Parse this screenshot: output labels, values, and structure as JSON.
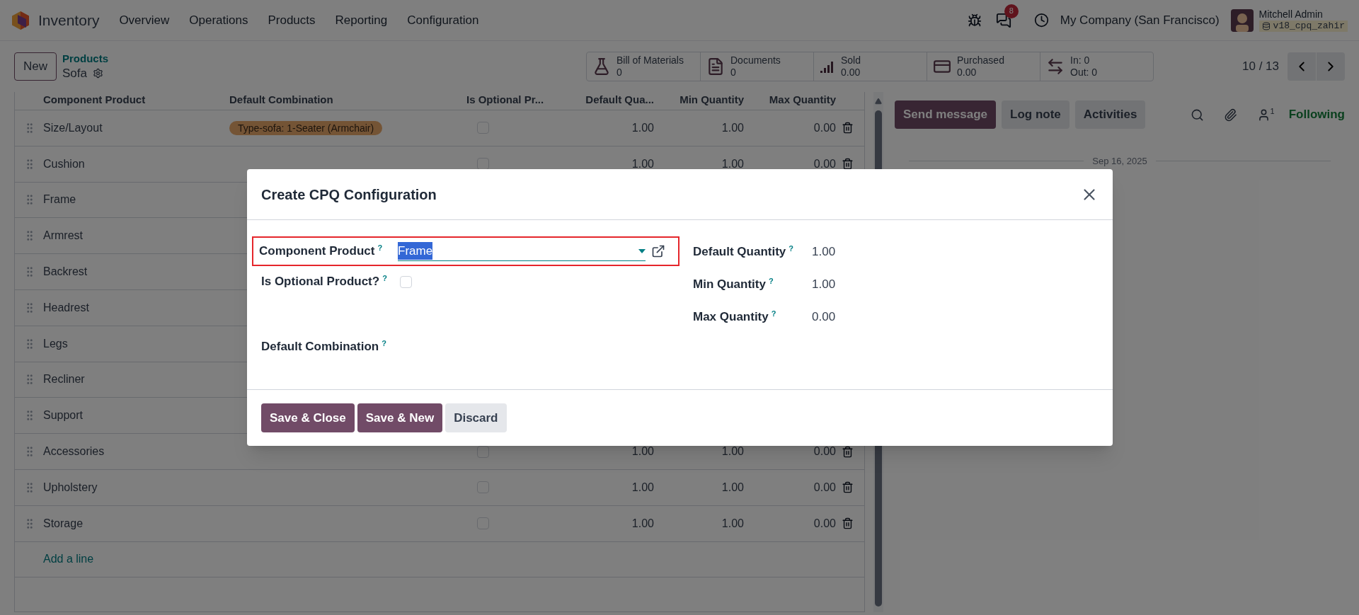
{
  "app": {
    "name": "Inventory",
    "menu": [
      "Overview",
      "Operations",
      "Products",
      "Reporting",
      "Configuration"
    ]
  },
  "systray": {
    "message_count": "8",
    "company": "My Company (San Francisco)",
    "user": "Mitchell Admin",
    "database": "v18_cpq_zahir"
  },
  "control_panel": {
    "new_button": "New",
    "breadcrumb": "Products",
    "record": "Sofa",
    "pager": "10 / 13",
    "smart_buttons": [
      {
        "kind": "flask",
        "label": "Bill of Materials",
        "value": "0"
      },
      {
        "kind": "document",
        "label": "Documents",
        "value": "0"
      },
      {
        "kind": "bars",
        "label": "Sold",
        "value": "0.00"
      },
      {
        "kind": "card",
        "label": "Purchased",
        "value": "0.00"
      },
      {
        "kind": "arrows",
        "label": "In: 0",
        "value": "Out: 0"
      }
    ]
  },
  "table": {
    "columns": [
      "Component Product",
      "Default Combination",
      "Is Optional Pr...",
      "Default Qua...",
      "Min Quantity",
      "Max Quantity"
    ],
    "rows": [
      {
        "name": "Size/Layout",
        "combination": "Type-sofa: 1-Seater (Armchair)",
        "optional": false,
        "default_qty": "1.00",
        "min_qty": "1.00",
        "max_qty": "0.00"
      },
      {
        "name": "Cushion",
        "optional": false,
        "default_qty": "1.00",
        "min_qty": "1.00",
        "max_qty": "0.00"
      },
      {
        "name": "Frame"
      },
      {
        "name": "Armrest"
      },
      {
        "name": "Backrest"
      },
      {
        "name": "Headrest"
      },
      {
        "name": "Legs"
      },
      {
        "name": "Recliner"
      },
      {
        "name": "Support"
      },
      {
        "name": "Accessories",
        "optional": false,
        "default_qty": "1.00",
        "min_qty": "1.00",
        "max_qty": "0.00"
      },
      {
        "name": "Upholstery",
        "optional": false,
        "default_qty": "1.00",
        "min_qty": "1.00",
        "max_qty": "0.00"
      },
      {
        "name": "Storage",
        "optional": false,
        "default_qty": "1.00",
        "min_qty": "1.00",
        "max_qty": "0.00"
      }
    ],
    "add_line": "Add a line"
  },
  "chatter": {
    "buttons": [
      {
        "label": "Send message",
        "kind": "primary"
      },
      {
        "label": "Log note",
        "kind": "secondary"
      },
      {
        "label": "Activities",
        "kind": "secondary"
      }
    ],
    "follower_count": "1",
    "following": "Following",
    "date": "Sep 16, 2025"
  },
  "dialog": {
    "title": "Create CPQ Configuration",
    "left_fields": [
      {
        "kind": "many2one",
        "label": "Component Product",
        "help": "?",
        "value": "Frame",
        "text_selected": true,
        "highlighted": true
      },
      {
        "kind": "checkbox",
        "label": "Is Optional Product?",
        "help": "?",
        "checked": false
      },
      {
        "kind": "tags",
        "label": "Default Combination",
        "help": "?"
      }
    ],
    "right_fields": [
      {
        "label": "Default Quantity",
        "help": "?",
        "value": "1.00"
      },
      {
        "label": "Min Quantity",
        "help": "?",
        "value": "1.00"
      },
      {
        "label": "Max Quantity",
        "help": "?",
        "value": "0.00"
      }
    ],
    "buttons": [
      {
        "label": "Save & Close",
        "kind": "primary"
      },
      {
        "label": "Save & New",
        "kind": "primary"
      },
      {
        "label": "Discard",
        "kind": "secondary"
      }
    ]
  }
}
